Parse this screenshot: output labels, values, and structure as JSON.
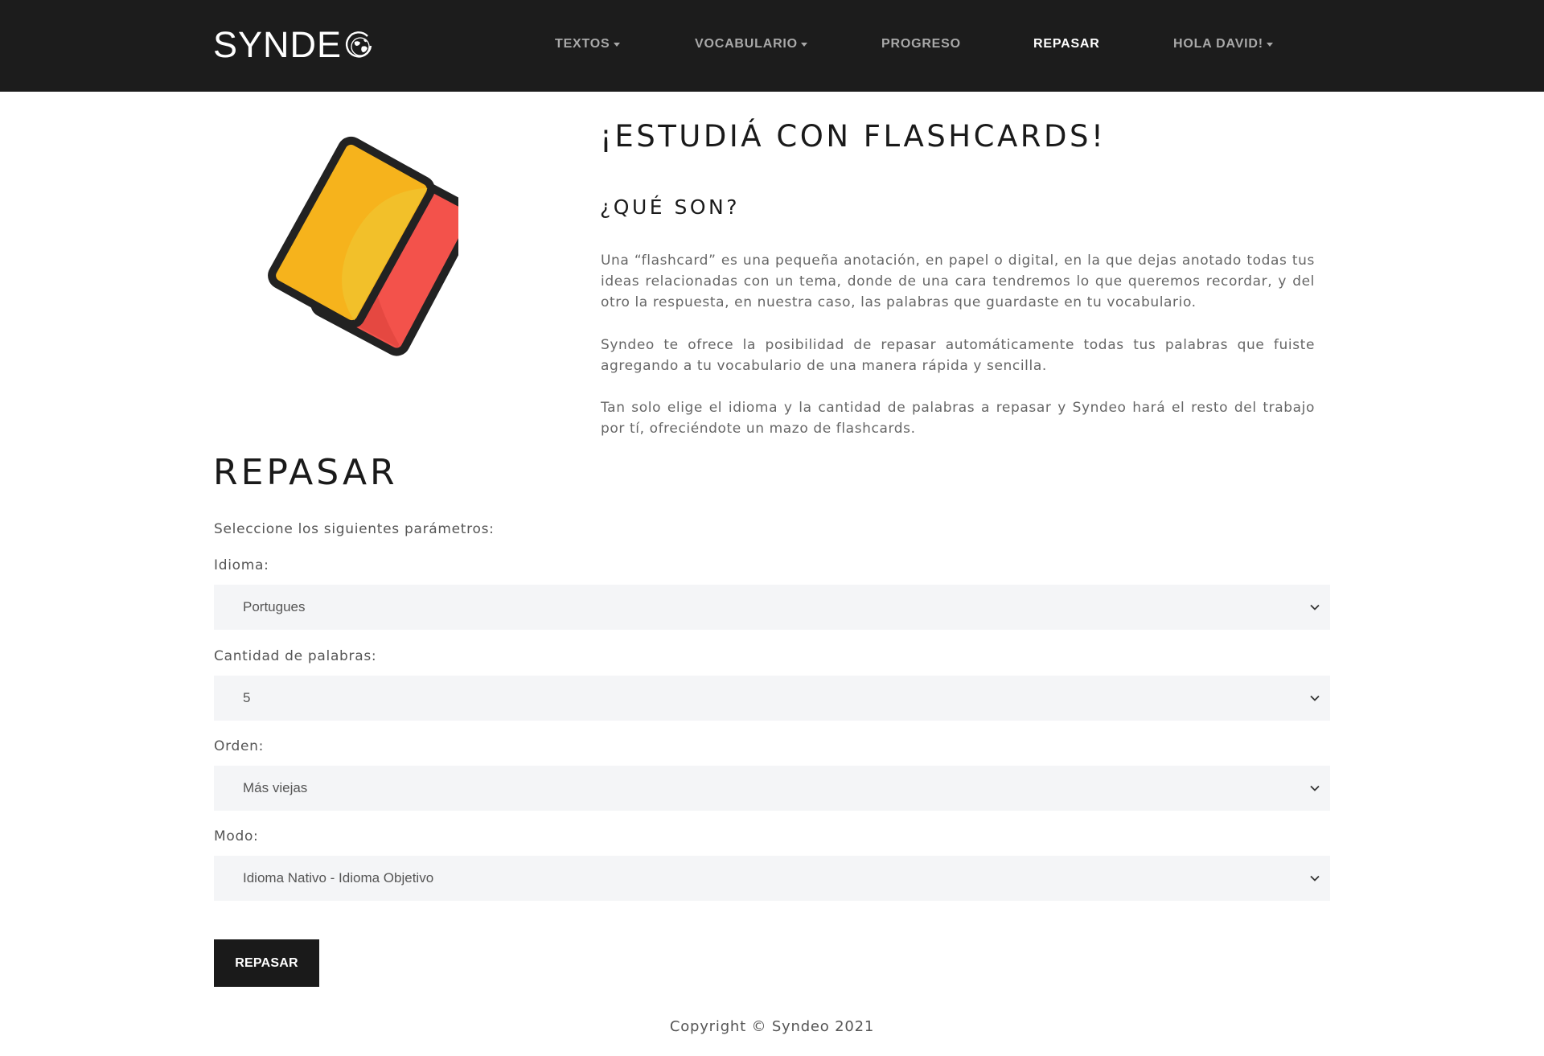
{
  "brand": {
    "name": "SYNDE"
  },
  "nav": {
    "items": [
      {
        "label": "TEXTOS"
      },
      {
        "label": "VOCABULARIO"
      },
      {
        "label": "PROGRESO"
      },
      {
        "label": "REPASAR"
      },
      {
        "label": "HOLA DAVID!"
      }
    ]
  },
  "hero": {
    "title": "¡ESTUDIÁ CON FLASHCARDS!",
    "subtitle": "¿QUÉ SON?",
    "paragraphs": [
      "Una “flashcard” es una pequeña anotación, en papel o digital, en la que dejas anotado todas tus ideas relacionadas con un tema, donde de una cara tendremos lo que queremos recordar, y del otro la respuesta, en nuestra caso, las palabras que guardaste en tu vocabulario.",
      "Syndeo te ofrece la posibilidad de repasar automáticamente todas tus palabras que fuiste agregando a tu vocabulario de una manera rápida y sencilla.",
      "Tan solo elige el idioma y la cantidad de palabras a repasar y Syndeo hará el resto del trabajo por tí, ofreciéndote un mazo de flashcards."
    ]
  },
  "review": {
    "title": "REPASAR",
    "instructions": "Seleccione los siguientes parámetros:",
    "fields": [
      {
        "label": "Idioma:",
        "value": "Portugues"
      },
      {
        "label": "Cantidad de palabras:",
        "value": "5"
      },
      {
        "label": "Orden:",
        "value": "Más viejas"
      },
      {
        "label": "Modo:",
        "value": "Idioma Nativo - Idioma Objetivo"
      }
    ],
    "submit_label": "REPASAR"
  },
  "footer": {
    "text": "Copyright © Syndeo 2021"
  },
  "colors": {
    "navbar": "#1c1c1c",
    "nav_inactive": "#a9a9a9",
    "nav_active": "#ffffff",
    "card_yellow": "#f6b31c",
    "card_red": "#f3524b",
    "select_bg": "#f4f5f7",
    "button_bg": "#1a1a1a"
  }
}
